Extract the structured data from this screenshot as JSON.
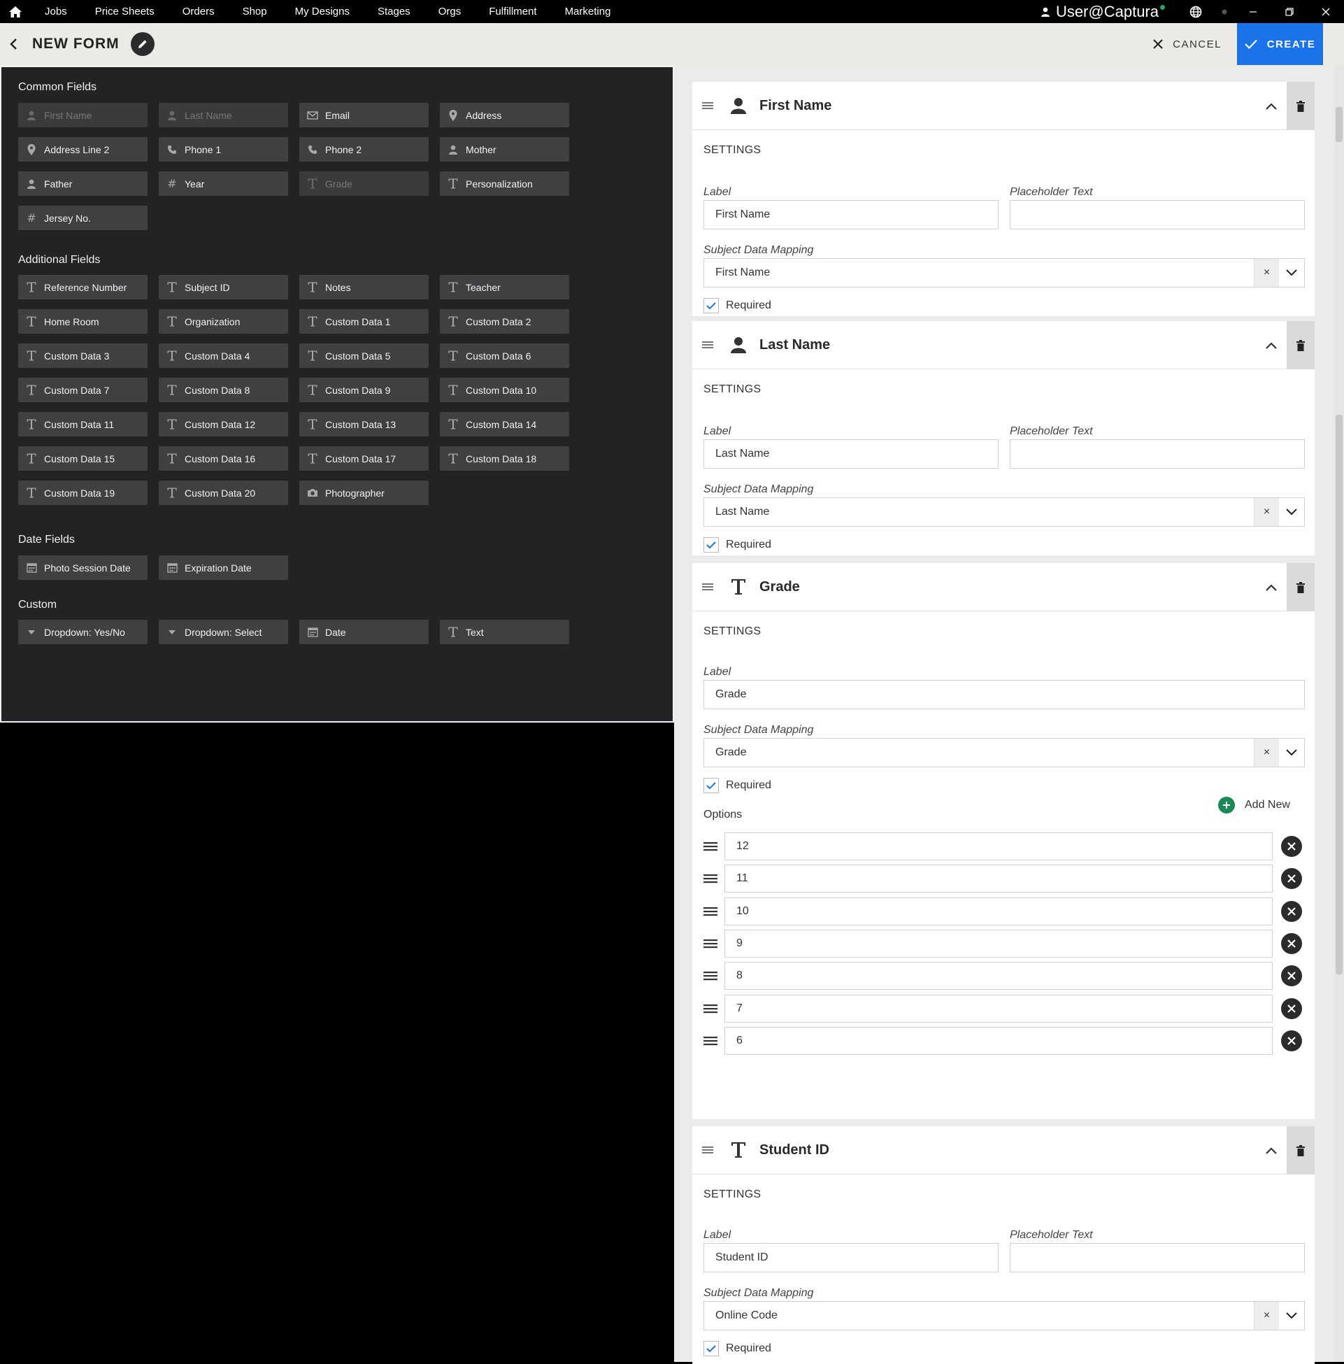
{
  "topnav": {
    "items": [
      "Jobs",
      "Price Sheets",
      "Orders",
      "Shop",
      "My Designs",
      "Stages",
      "Orgs",
      "Fulfillment",
      "Marketing"
    ],
    "user": "User@Captura"
  },
  "header": {
    "title": "NEW FORM",
    "cancel_label": "CANCEL",
    "create_label": "CREATE"
  },
  "palette": {
    "common_title": "Common Fields",
    "common": [
      {
        "label": "First Name",
        "icon": "person-icon",
        "disabled": true
      },
      {
        "label": "Last Name",
        "icon": "person-icon",
        "disabled": true
      },
      {
        "label": "Email",
        "icon": "envelope-icon",
        "disabled": false
      },
      {
        "label": "Address",
        "icon": "location-pin-icon",
        "disabled": false
      },
      {
        "label": "Address Line 2",
        "icon": "location-pin-icon",
        "disabled": false
      },
      {
        "label": "Phone 1",
        "icon": "phone-icon",
        "disabled": false
      },
      {
        "label": "Phone 2",
        "icon": "phone-icon",
        "disabled": false
      },
      {
        "label": "Mother",
        "icon": "person-icon",
        "disabled": false
      },
      {
        "label": "Father",
        "icon": "person-icon",
        "disabled": false
      },
      {
        "label": "Year",
        "icon": "hash-icon",
        "disabled": false
      },
      {
        "label": "Grade",
        "icon": "text-icon",
        "disabled": true
      },
      {
        "label": "Personalization",
        "icon": "text-icon",
        "disabled": false
      },
      {
        "label": "Jersey No.",
        "icon": "hash-icon",
        "disabled": false
      }
    ],
    "additional_title": "Additional Fields",
    "additional": [
      {
        "label": "Reference Number",
        "icon": "text-icon"
      },
      {
        "label": "Subject ID",
        "icon": "text-icon"
      },
      {
        "label": "Notes",
        "icon": "text-icon"
      },
      {
        "label": "Teacher",
        "icon": "text-icon"
      },
      {
        "label": "Home Room",
        "icon": "text-icon"
      },
      {
        "label": "Organization",
        "icon": "text-icon"
      },
      {
        "label": "Custom Data 1",
        "icon": "text-icon"
      },
      {
        "label": "Custom Data 2",
        "icon": "text-icon"
      },
      {
        "label": "Custom Data 3",
        "icon": "text-icon"
      },
      {
        "label": "Custom Data 4",
        "icon": "text-icon"
      },
      {
        "label": "Custom Data 5",
        "icon": "text-icon"
      },
      {
        "label": "Custom Data 6",
        "icon": "text-icon"
      },
      {
        "label": "Custom Data 7",
        "icon": "text-icon"
      },
      {
        "label": "Custom Data 8",
        "icon": "text-icon"
      },
      {
        "label": "Custom Data 9",
        "icon": "text-icon"
      },
      {
        "label": "Custom Data 10",
        "icon": "text-icon"
      },
      {
        "label": "Custom Data 11",
        "icon": "text-icon"
      },
      {
        "label": "Custom Data 12",
        "icon": "text-icon"
      },
      {
        "label": "Custom Data 13",
        "icon": "text-icon"
      },
      {
        "label": "Custom Data 14",
        "icon": "text-icon"
      },
      {
        "label": "Custom Data 15",
        "icon": "text-icon"
      },
      {
        "label": "Custom Data 16",
        "icon": "text-icon"
      },
      {
        "label": "Custom Data 17",
        "icon": "text-icon"
      },
      {
        "label": "Custom Data 18",
        "icon": "text-icon"
      },
      {
        "label": "Custom Data 19",
        "icon": "text-icon"
      },
      {
        "label": "Custom Data 20",
        "icon": "text-icon"
      },
      {
        "label": "Photographer",
        "icon": "camera-icon"
      }
    ],
    "date_title": "Date Fields",
    "date": [
      {
        "label": "Photo Session Date",
        "icon": "calendar-icon"
      },
      {
        "label": "Expiration Date",
        "icon": "calendar-icon"
      }
    ],
    "custom_title": "Custom",
    "custom": [
      {
        "label": "Dropdown: Yes/No",
        "icon": "caret-down-icon"
      },
      {
        "label": "Dropdown: Select",
        "icon": "caret-down-icon"
      },
      {
        "label": "Date",
        "icon": "calendar-icon"
      },
      {
        "label": "Text",
        "icon": "text-icon"
      }
    ]
  },
  "form": {
    "settings_label": "SETTINGS",
    "label_label": "Label",
    "placeholder_label": "Placeholder Text",
    "mapping_label": "Subject Data Mapping",
    "required_label": "Required",
    "options_label": "Options",
    "add_new_label": "Add New",
    "cards": [
      {
        "title": "First Name",
        "icon": "person-icon",
        "label": "First Name",
        "placeholder": "",
        "mapping": "First Name",
        "required": true
      },
      {
        "title": "Last Name",
        "icon": "person-icon",
        "label": "Last Name",
        "placeholder": "",
        "mapping": "Last Name",
        "required": true
      },
      {
        "title": "Grade",
        "icon": "text-icon",
        "label": "Grade",
        "mapping": "Grade",
        "required": true,
        "options": [
          "12",
          "11",
          "10",
          "9",
          "8",
          "7",
          "6"
        ]
      },
      {
        "title": "Student ID",
        "icon": "text-icon",
        "label": "Student ID",
        "placeholder": "",
        "mapping": "Online Code",
        "required": true
      }
    ]
  },
  "colors": {
    "accent": "#1a73e8",
    "add_green": "#1a8a55",
    "palette_bg": "#232325",
    "chip_bg": "#404042"
  }
}
